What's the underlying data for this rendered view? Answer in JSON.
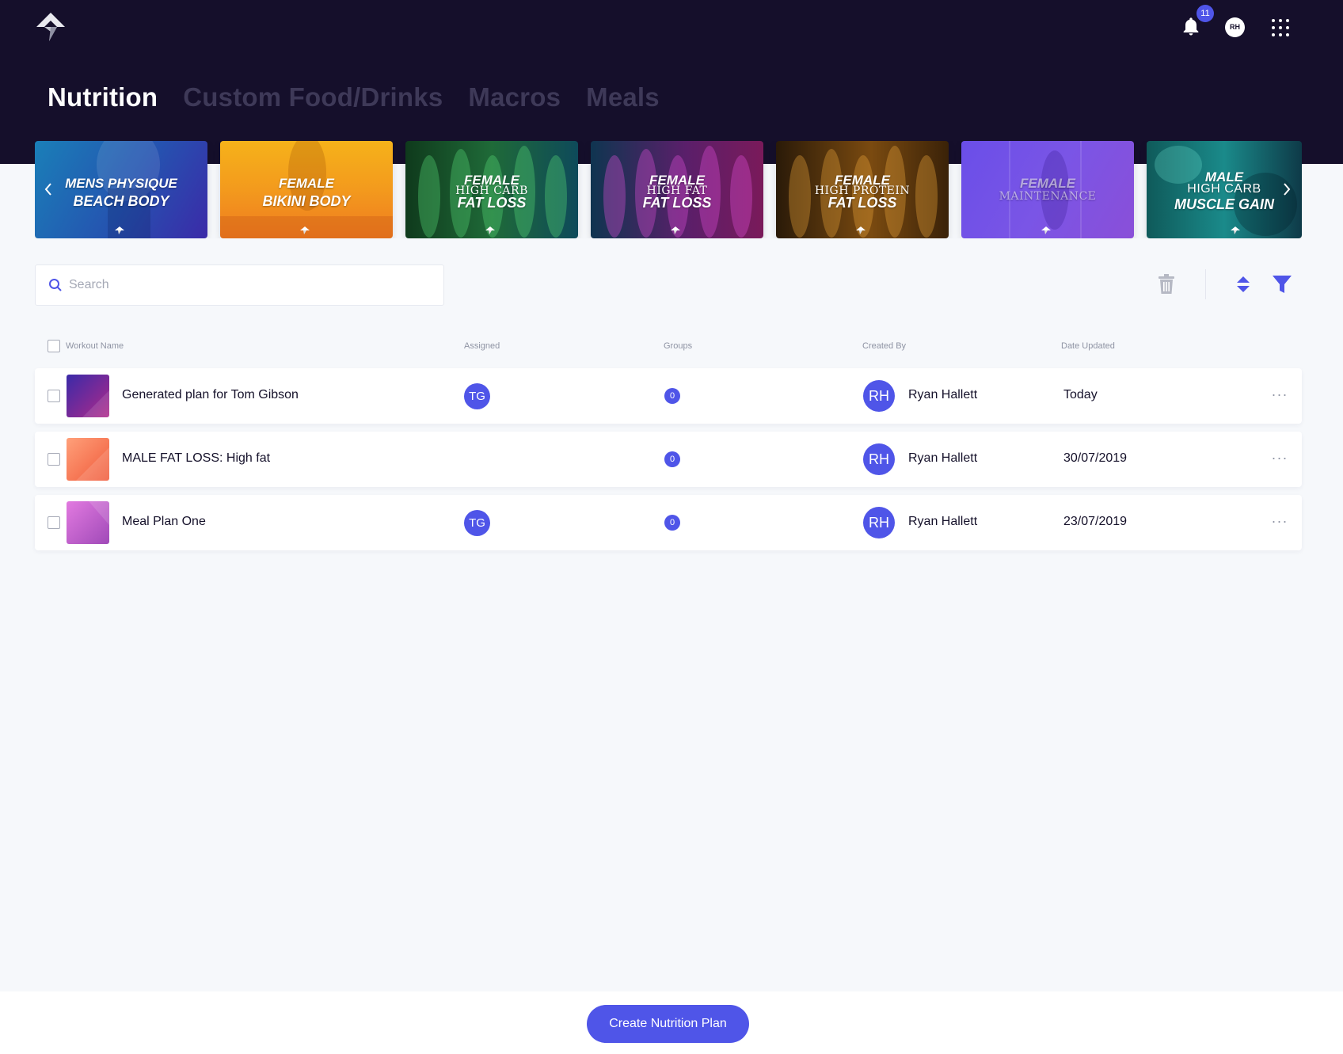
{
  "header": {
    "logo_icon": "arrow-logo-icon",
    "notifications": {
      "icon": "bell-icon",
      "count": "11"
    },
    "user_initials": "RH",
    "apps_icon": "grid-dots-icon"
  },
  "tabs": [
    {
      "label": "Nutrition",
      "active": true
    },
    {
      "label": "Custom Food/Drinks",
      "active": false
    },
    {
      "label": "Macros",
      "active": false
    },
    {
      "label": "Meals",
      "active": false
    }
  ],
  "carousel": {
    "prev_icon": "chevron-left-icon",
    "next_icon": "chevron-right-icon",
    "cards": [
      {
        "line1": "MENS PHYSIQUE",
        "line2": "",
        "line3": "BEACH BODY"
      },
      {
        "line1": "FEMALE",
        "line2": "",
        "line3": "BIKINI BODY"
      },
      {
        "line1": "FEMALE",
        "line2": "HIGH CARB",
        "line3": "FAT LOSS"
      },
      {
        "line1": "FEMALE",
        "line2": "HIGH FAT",
        "line3": "FAT LOSS"
      },
      {
        "line1": "FEMALE",
        "line2": "HIGH PROTEIN",
        "line3": "FAT LOSS"
      },
      {
        "line1": "FEMALE",
        "line2": "",
        "line3": "MAINTENANCE"
      },
      {
        "line1": "MALE",
        "line2": "HIGH CARB",
        "line3": "MUSCLE GAIN"
      }
    ]
  },
  "toolbar": {
    "search_placeholder": "Search",
    "search_value": "",
    "delete_icon": "trash-icon",
    "sort_icon": "sort-icon",
    "filter_icon": "filter-icon"
  },
  "table": {
    "columns": {
      "name": "Workout Name",
      "assigned": "Assigned",
      "groups": "Groups",
      "created_by": "Created By",
      "date_updated": "Date Updated"
    },
    "rows": [
      {
        "name": "Generated plan for Tom Gibson",
        "assigned": "TG",
        "groups": "0",
        "creator_initials": "RH",
        "creator": "Ryan Hallett",
        "date": "Today",
        "thumb_color": "#6a2cc0",
        "more": "···"
      },
      {
        "name": "MALE FAT LOSS: High fat",
        "assigned": "",
        "groups": "0",
        "creator_initials": "RH",
        "creator": "Ryan Hallett",
        "date": "30/07/2019",
        "thumb_color": "#ff7e5f",
        "more": "···"
      },
      {
        "name": "Meal Plan One",
        "assigned": "TG",
        "groups": "0",
        "creator_initials": "RH",
        "creator": "Ryan Hallett",
        "date": "23/07/2019",
        "thumb_color": "#d06ed8",
        "more": "···"
      }
    ]
  },
  "footer": {
    "create_label": "Create Nutrition Plan"
  },
  "colors": {
    "accent": "#4f55e8",
    "header_bg": "#150f2b",
    "page_bg": "#f6f8fb"
  }
}
